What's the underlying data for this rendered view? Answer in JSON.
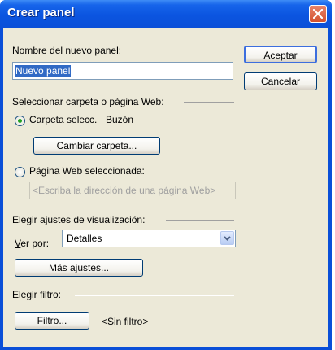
{
  "window": {
    "title": "Crear panel"
  },
  "form": {
    "name_label": "Nombre del nuevo panel:",
    "name_value": "Nuevo panel",
    "accept_label": "Aceptar",
    "cancel_label": "Cancelar",
    "select_section_label": "Seleccionar carpeta o página Web:",
    "folder_radio_label": "Carpeta selecc.",
    "folder_value": "Buzón",
    "change_folder_label": "Cambiar carpeta...",
    "webpage_radio_label": "Página Web seleccionada:",
    "webpage_placeholder": "<Escriba la dirección de una página Web>",
    "view_section_label": "Elegir ajustes de visualización:",
    "view_by_label": "Ver por:",
    "view_by_value": "Detalles",
    "more_settings_label": "Más ajustes...",
    "filter_section_label": "Elegir filtro:",
    "filter_button_label": "Filtro...",
    "filter_value": "<Sin filtro>",
    "selected_radio": "folder"
  },
  "icons": {
    "close": "close-icon",
    "dropdown": "chevron-down-icon"
  },
  "colors": {
    "titlebar": "#0a4fd8",
    "dialog_bg": "#ece9d8",
    "selection": "#316ac5",
    "radio_dot": "#21a121",
    "close_button": "#d4512e"
  }
}
